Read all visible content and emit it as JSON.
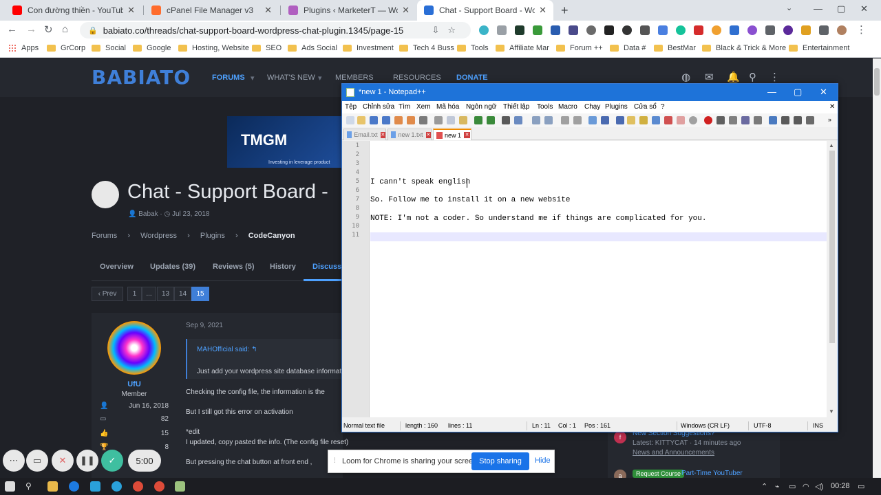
{
  "browser": {
    "tabs": [
      {
        "title": "Con đường thiền - YouTube",
        "color": "#ff0000"
      },
      {
        "title": "cPanel File Manager v3",
        "color": "#ff6c2c"
      },
      {
        "title": "Plugins ‹ MarketerT — WordPress",
        "color": "#b05fc0"
      },
      {
        "title": "Chat - Support Board - WordPress",
        "color": "#2a6fd6"
      }
    ],
    "url": "babiato.co/threads/chat-support-board-wordpress-chat-plugin.1345/page-15",
    "bookmarks": [
      "Apps",
      "GrCorp",
      "Social",
      "Google",
      "Hosting, Website",
      "SEO",
      "Ads Social",
      "Investment",
      "Tech 4 Buss",
      "Tools",
      "Affiliate Mar",
      "Forum ++",
      "Data #",
      "BestMar",
      "Black & Trick & More",
      "Entertainment"
    ]
  },
  "site": {
    "logo": "BABIATO",
    "nav": [
      "FORUMS",
      "WHAT'S NEW",
      "MEMBERS",
      "RESOURCES",
      "DONATE"
    ],
    "banner": {
      "brand": "TMGM",
      "tagline": "Investing in leverage product"
    },
    "thread_title": "Chat - Support Board -",
    "thread_author": "Babak",
    "thread_date": "Jul 23, 2018",
    "breadcrumbs": [
      "Forums",
      "Wordpress",
      "Plugins",
      "CodeCanyon"
    ],
    "tabs": [
      "Overview",
      "Updates (39)",
      "Reviews (5)",
      "History",
      "Discussi"
    ],
    "pager": [
      "‹ Prev",
      "1",
      "...",
      "13",
      "14",
      "15"
    ],
    "post": {
      "username": "UfU",
      "role": "Member",
      "joined": "Jun 16, 2018",
      "messages": "82",
      "reactions": "15",
      "points": "8",
      "date": "Sep 9, 2021",
      "quote_author": "MAHOfficial said:",
      "quote_text": "Just add your wordpress site database informati",
      "lines": [
        "Checking the config file, the information is the",
        "But I still got this error on activation",
        "*edit",
        "I updated, copy pasted the info. (The config file reset)",
        "But pressing the chat button at front end ,"
      ]
    },
    "sidebar": {
      "item1_title": "New Section Suggestions?",
      "item1_meta": "Latest: KITTYCAT · 14 minutes ago",
      "item1_forum": "News and Announcements",
      "item2_badge": "Request Course",
      "item2_title": "Part-Time YouTuber"
    }
  },
  "notepad": {
    "title": "*new 1 - Notepad++",
    "menu": [
      "Tệp",
      "Chỉnh sửa",
      "Tìm",
      "Xem",
      "Mã hóa",
      "Ngôn ngữ",
      "Thiết lập",
      "Tools",
      "Macro",
      "Chạy",
      "Plugins",
      "Cửa sổ",
      "?"
    ],
    "doc_tabs": [
      "Email.txt",
      "new 1.txt",
      "new 1"
    ],
    "lines": [
      "",
      "",
      "",
      "",
      "I cann't speak english",
      "",
      "So. Follow me to install it on a new website",
      "",
      "NOTE: I'm not a coder. So understand me if things are complicated for you.",
      "",
      ""
    ],
    "line_numbers": [
      "1",
      "2",
      "3",
      "4",
      "5",
      "6",
      "7",
      "8",
      "9",
      "10",
      "11"
    ],
    "status": {
      "type": "Normal text file",
      "length": "length : 160",
      "lines": "lines : 11",
      "ln": "Ln : 11",
      "col": "Col : 1",
      "pos": "Pos : 161",
      "eol": "Windows (CR LF)",
      "enc": "UTF-8",
      "mode": "INS"
    }
  },
  "loom": {
    "timer": "5:00",
    "share_text": "Loom for Chrome is sharing your screen.",
    "stop_label": "Stop sharing",
    "hide_label": "Hide"
  },
  "taskbar": {
    "time": "00:28"
  }
}
